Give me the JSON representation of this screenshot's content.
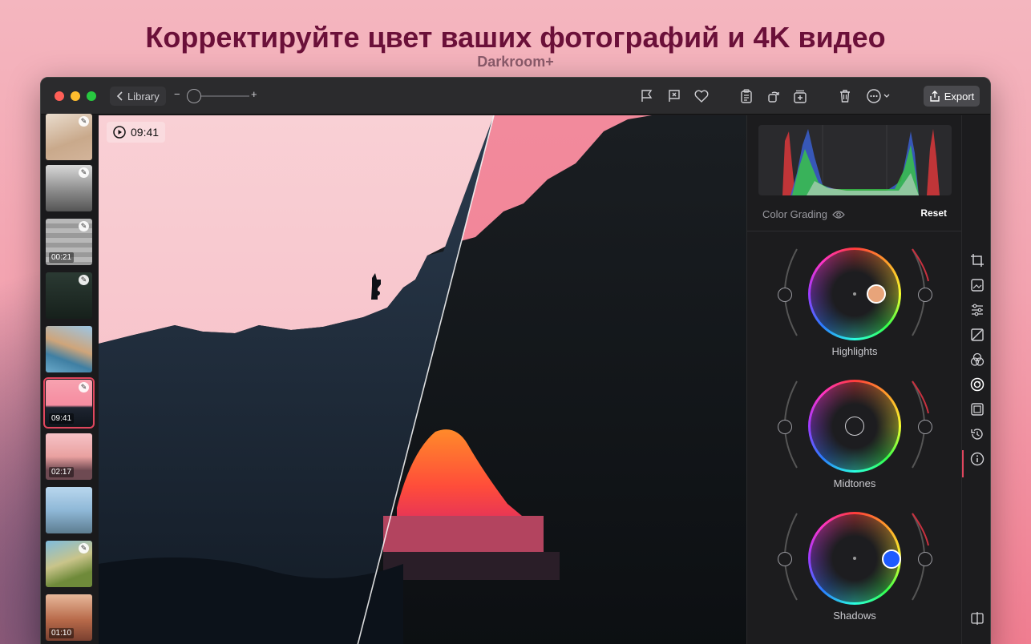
{
  "headline": "Корректируйте цвет ваших фотографий и 4K видео",
  "subheadline": "Darkroom+",
  "toolbar": {
    "back_label": "Library",
    "zoom_minus": "−",
    "zoom_plus": "+",
    "export_label": "Export",
    "icons": [
      "flag-icon",
      "reject-icon",
      "heart-icon",
      "clipboard-icon",
      "rotate-icon",
      "add-to-album-icon",
      "trash-icon",
      "more-icon"
    ]
  },
  "filmstrip": {
    "thumbs": [
      {
        "duration": ""
      },
      {
        "duration": ""
      },
      {
        "duration": "00:21"
      },
      {
        "duration": ""
      },
      {
        "duration": ""
      },
      {
        "duration": "09:41"
      },
      {
        "duration": "02:17"
      },
      {
        "duration": ""
      },
      {
        "duration": ""
      },
      {
        "duration": "01:10"
      }
    ]
  },
  "canvas": {
    "time": "09:41"
  },
  "panel": {
    "section_label": "Color Grading",
    "reset_label": "Reset",
    "wheels": [
      {
        "label": "Highlights",
        "knob_color": "#e8a47a"
      },
      {
        "label": "Midtones",
        "knob_color": ""
      },
      {
        "label": "Shadows",
        "knob_color": "#1e5bff"
      }
    ]
  },
  "rightbar": {
    "icons": [
      "crop-icon",
      "image-icon",
      "sliders-icon",
      "curves-icon",
      "color-mixer-icon",
      "color-grading-icon",
      "frame-icon",
      "history-icon",
      "info-icon",
      "compare-icon"
    ],
    "active": "color-grading-icon"
  },
  "colors": {
    "accent": "#e0465e",
    "headline": "#6b1039"
  }
}
